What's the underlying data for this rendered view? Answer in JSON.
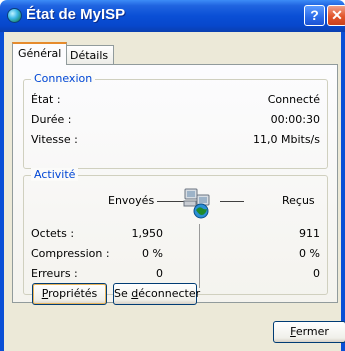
{
  "window": {
    "title": "État de MyISP",
    "icon": "globe-icon"
  },
  "titlebar_buttons": {
    "help": "?",
    "close": "✕"
  },
  "tabs": [
    {
      "label": "Général",
      "active": true
    },
    {
      "label": "Détails",
      "active": false
    }
  ],
  "connection": {
    "legend": "Connexion",
    "rows": [
      {
        "label": "État :",
        "value": "Connecté"
      },
      {
        "label": "Durée :",
        "value": "00:00:30"
      },
      {
        "label": "Vitesse :",
        "value": "11,0 Mbits/s"
      }
    ]
  },
  "activity": {
    "legend": "Activité",
    "sent_header": "Envoyés",
    "received_header": "Reçus",
    "rows": [
      {
        "label": "Octets :",
        "sent": "1,950",
        "received": "911"
      },
      {
        "label": "Compression :",
        "sent": "0 %",
        "received": "0 %"
      },
      {
        "label": "Erreurs :",
        "sent": "0",
        "received": "0"
      }
    ]
  },
  "buttons": {
    "properties": {
      "first": "P",
      "rest": "ropriétés"
    },
    "disconnect": {
      "before": "Se ",
      "underlined": "d",
      "after": "éconnecter"
    },
    "close": {
      "first": "F",
      "rest": "ermer"
    }
  },
  "colors": {
    "titlebar": "#0a4fd6",
    "legend": "#0046d5",
    "active_tab": "#e68b2c",
    "face": "#ece9d8"
  }
}
